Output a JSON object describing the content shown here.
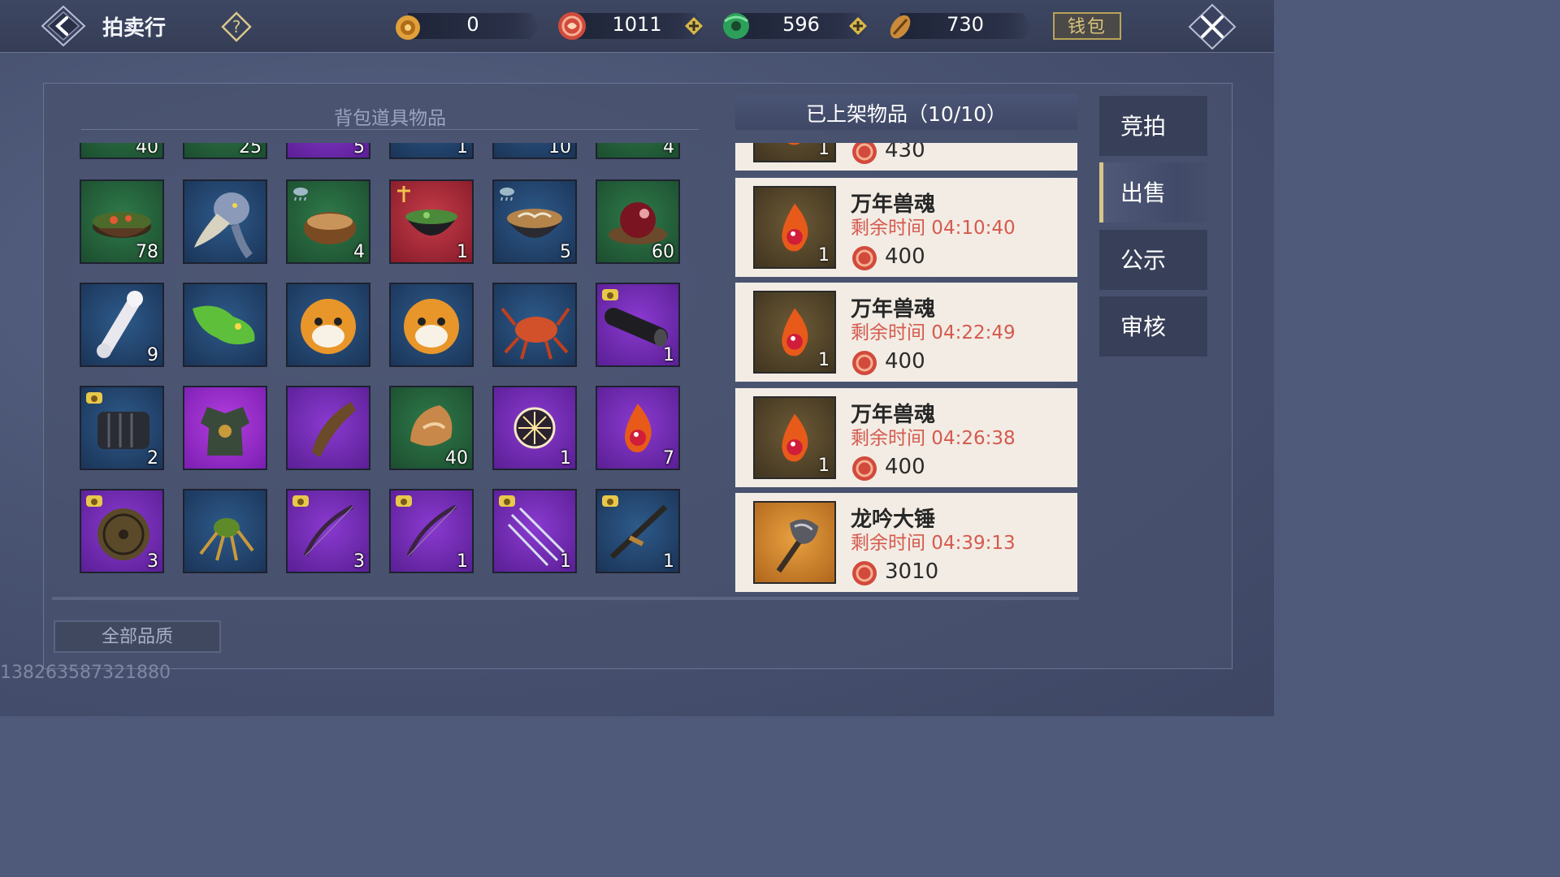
{
  "header": {
    "title": "拍卖行",
    "wallet_label": "钱包",
    "currencies": [
      {
        "icon": "bronze-token-icon",
        "value": "0"
      },
      {
        "icon": "red-coin-icon",
        "value": "1011"
      },
      {
        "icon": "jade-icon",
        "value": "596"
      },
      {
        "icon": "shell-coin-icon",
        "value": "730"
      }
    ]
  },
  "inventory": {
    "title": "背包道具物品",
    "partial_row_qty": [
      "40",
      "25",
      "5",
      "1",
      "10",
      "4"
    ],
    "items": [
      {
        "icon": "vegetable-soup-icon",
        "quality": "green",
        "qty": "78"
      },
      {
        "icon": "shoebill-bird-icon",
        "quality": "blue",
        "qty": ""
      },
      {
        "icon": "porridge-bowl-icon",
        "quality": "green",
        "qty": "4"
      },
      {
        "icon": "herb-soup-bowl-icon",
        "quality": "red",
        "qty": "1"
      },
      {
        "icon": "rice-bowl-icon",
        "quality": "blue",
        "qty": "5"
      },
      {
        "icon": "red-fruit-plate-icon",
        "quality": "green",
        "qty": "60"
      },
      {
        "icon": "bone-icon",
        "quality": "blue",
        "qty": "9"
      },
      {
        "icon": "green-creature-icon",
        "quality": "blue",
        "qty": ""
      },
      {
        "icon": "red-panda-icon",
        "quality": "blue",
        "qty": ""
      },
      {
        "icon": "red-panda-icon",
        "quality": "blue",
        "qty": ""
      },
      {
        "icon": "crab-icon",
        "quality": "blue",
        "qty": ""
      },
      {
        "icon": "barrel-tube-icon",
        "quality": "purple",
        "qty": "1"
      },
      {
        "icon": "armor-plates-icon",
        "quality": "blue",
        "qty": "2"
      },
      {
        "icon": "chest-armor-icon",
        "quality": "magenta",
        "qty": ""
      },
      {
        "icon": "horn-icon",
        "quality": "purple",
        "qty": ""
      },
      {
        "icon": "meat-chunk-icon",
        "quality": "green",
        "qty": "40"
      },
      {
        "icon": "glowing-orb-icon",
        "quality": "purple",
        "qty": "1"
      },
      {
        "icon": "beast-soul-flame-icon",
        "quality": "purple",
        "qty": "7"
      },
      {
        "icon": "round-shield-icon",
        "quality": "purple",
        "qty": "3"
      },
      {
        "icon": "spider-icon",
        "quality": "blue",
        "qty": ""
      },
      {
        "icon": "bow-icon",
        "quality": "purple",
        "qty": "3"
      },
      {
        "icon": "bow-icon",
        "quality": "purple",
        "qty": "1"
      },
      {
        "icon": "arrows-icon",
        "quality": "purple",
        "qty": "1"
      },
      {
        "icon": "rifle-icon",
        "quality": "blue",
        "qty": "1"
      }
    ]
  },
  "listings": {
    "title": "已上架物品（10/10）",
    "partial_top": {
      "qty": "1",
      "price": "430"
    },
    "entries": [
      {
        "name": "万年兽魂",
        "time": "剩余时间 04:10:40",
        "price": "400",
        "qty": "1",
        "icon": "beast-soul-flame-icon"
      },
      {
        "name": "万年兽魂",
        "time": "剩余时间 04:22:49",
        "price": "400",
        "qty": "1",
        "icon": "beast-soul-flame-icon"
      },
      {
        "name": "万年兽魂",
        "time": "剩余时间 04:26:38",
        "price": "400",
        "qty": "1",
        "icon": "beast-soul-flame-icon"
      },
      {
        "name": "龙吟大锤",
        "time": "剩余时间 04:39:13",
        "price": "3010",
        "qty": "",
        "icon": "war-hammer-icon"
      }
    ]
  },
  "tabs": [
    {
      "label": "竞拍",
      "active": false
    },
    {
      "label": "出售",
      "active": true
    },
    {
      "label": "公示",
      "active": false
    },
    {
      "label": "审核",
      "active": false
    }
  ],
  "quality_filter": "全部品质",
  "player_id": "138263587321880",
  "colors": {
    "accent_gold": "#d8c78a",
    "timer_red": "#d55a4e",
    "panel": "#48526e"
  }
}
